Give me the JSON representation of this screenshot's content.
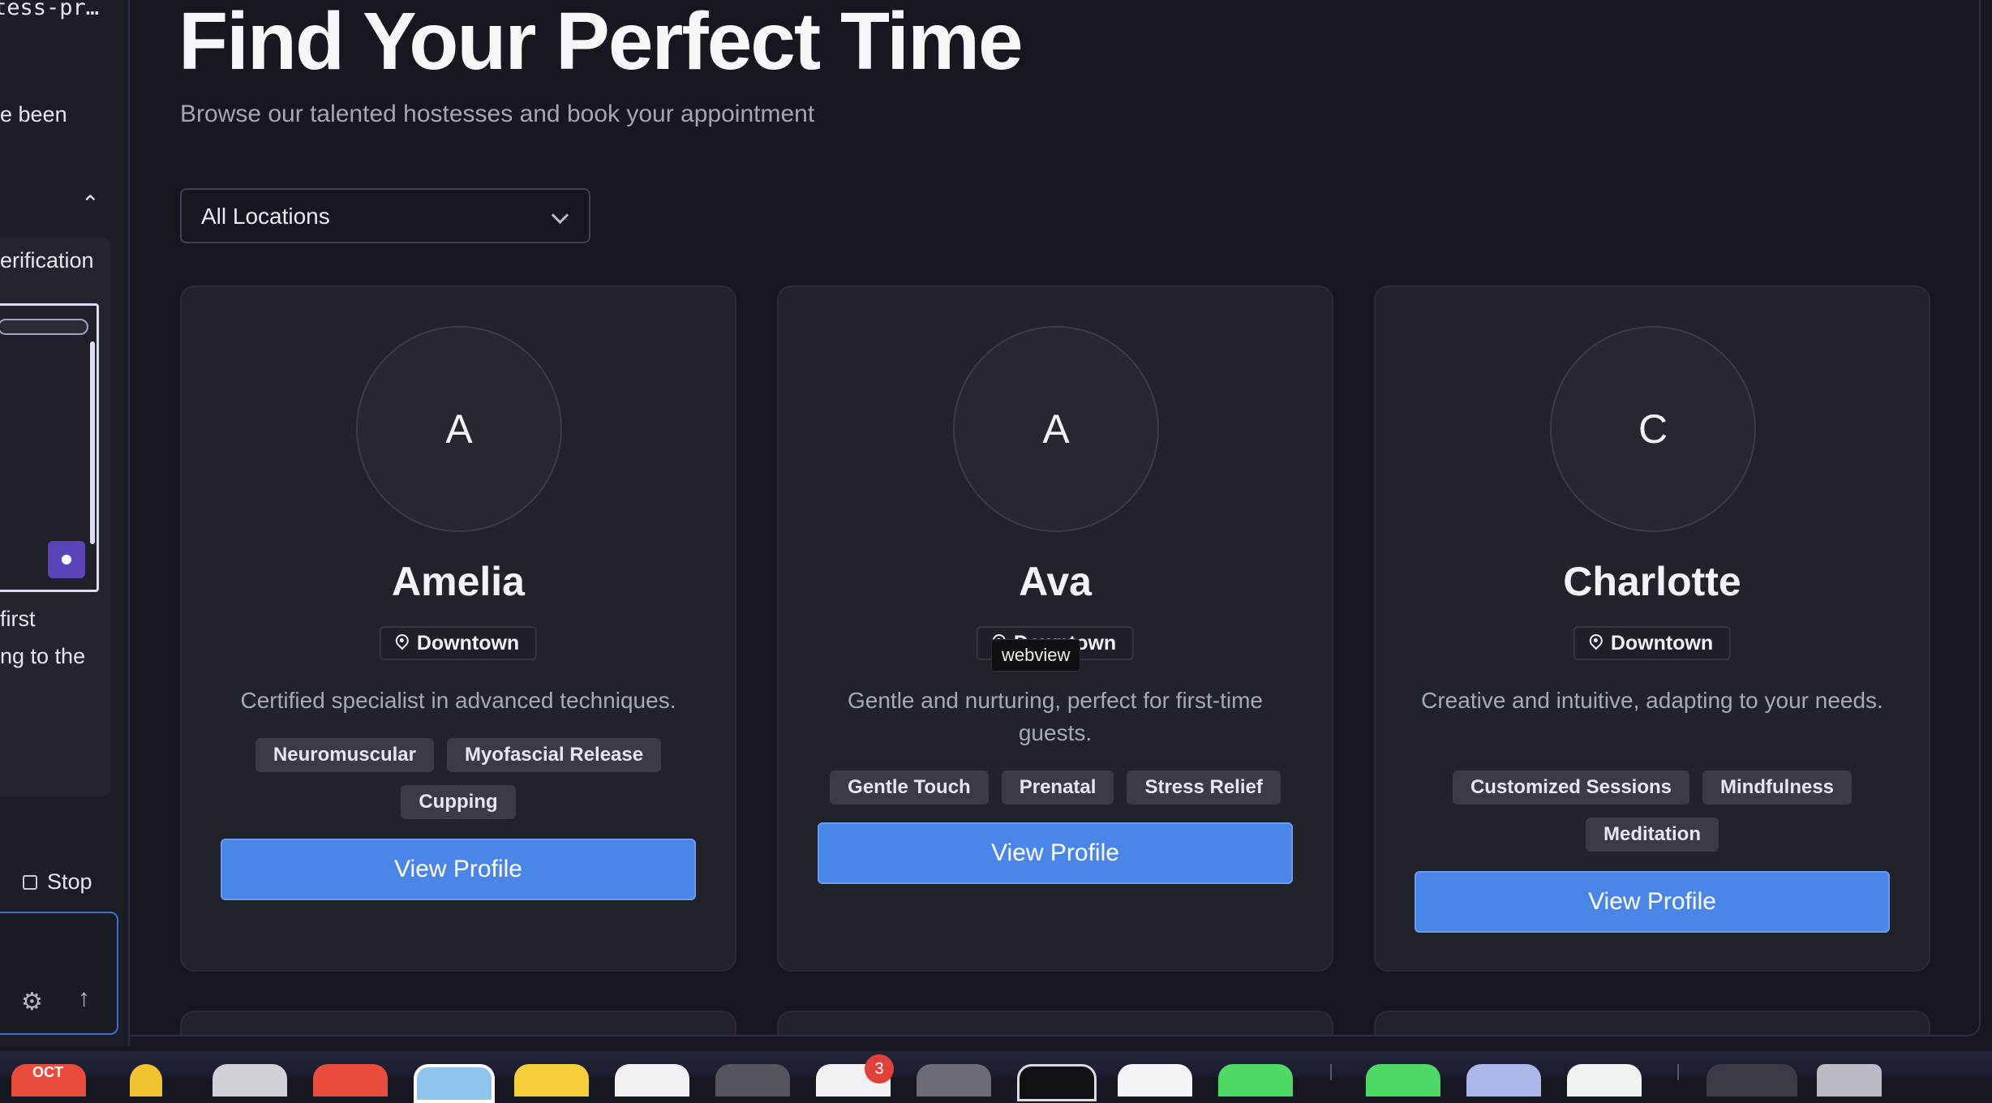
{
  "sidebar": {
    "path_text": "tess-pr…",
    "line1": "e been",
    "verification_label": "erification",
    "caption_line1": "first",
    "caption_line2": "ng to the",
    "stop_label": "Stop"
  },
  "page": {
    "title": "Find Your Perfect Time",
    "subtitle": "Browse our talented hostesses and book your appointment"
  },
  "filter": {
    "location_selected": "All Locations"
  },
  "hostesses": [
    {
      "initial": "A",
      "name": "Amelia",
      "location": "Downtown",
      "description": "Certified specialist in advanced techniques.",
      "tags": [
        "Neuromuscular",
        "Myofascial Release",
        "Cupping"
      ],
      "button_label": "View Profile"
    },
    {
      "initial": "A",
      "name": "Ava",
      "location": "Downtown",
      "description": "Gentle and nurturing, perfect for first-time guests.",
      "tags": [
        "Gentle Touch",
        "Prenatal",
        "Stress Relief"
      ],
      "button_label": "View Profile"
    },
    {
      "initial": "C",
      "name": "Charlotte",
      "location": "Downtown",
      "description": "Creative and intuitive, adapting to your needs.",
      "tags": [
        "Customized Sessions",
        "Mindfulness",
        "Meditation"
      ],
      "button_label": "View Profile"
    }
  ],
  "tooltip": {
    "text": "webview"
  },
  "dock": {
    "calendar_month": "OCT",
    "notification_count": "3"
  },
  "colors": {
    "accent_button": "#4a86e8",
    "background": "#17181f",
    "card": "#21232b",
    "tag": "#393b45"
  }
}
